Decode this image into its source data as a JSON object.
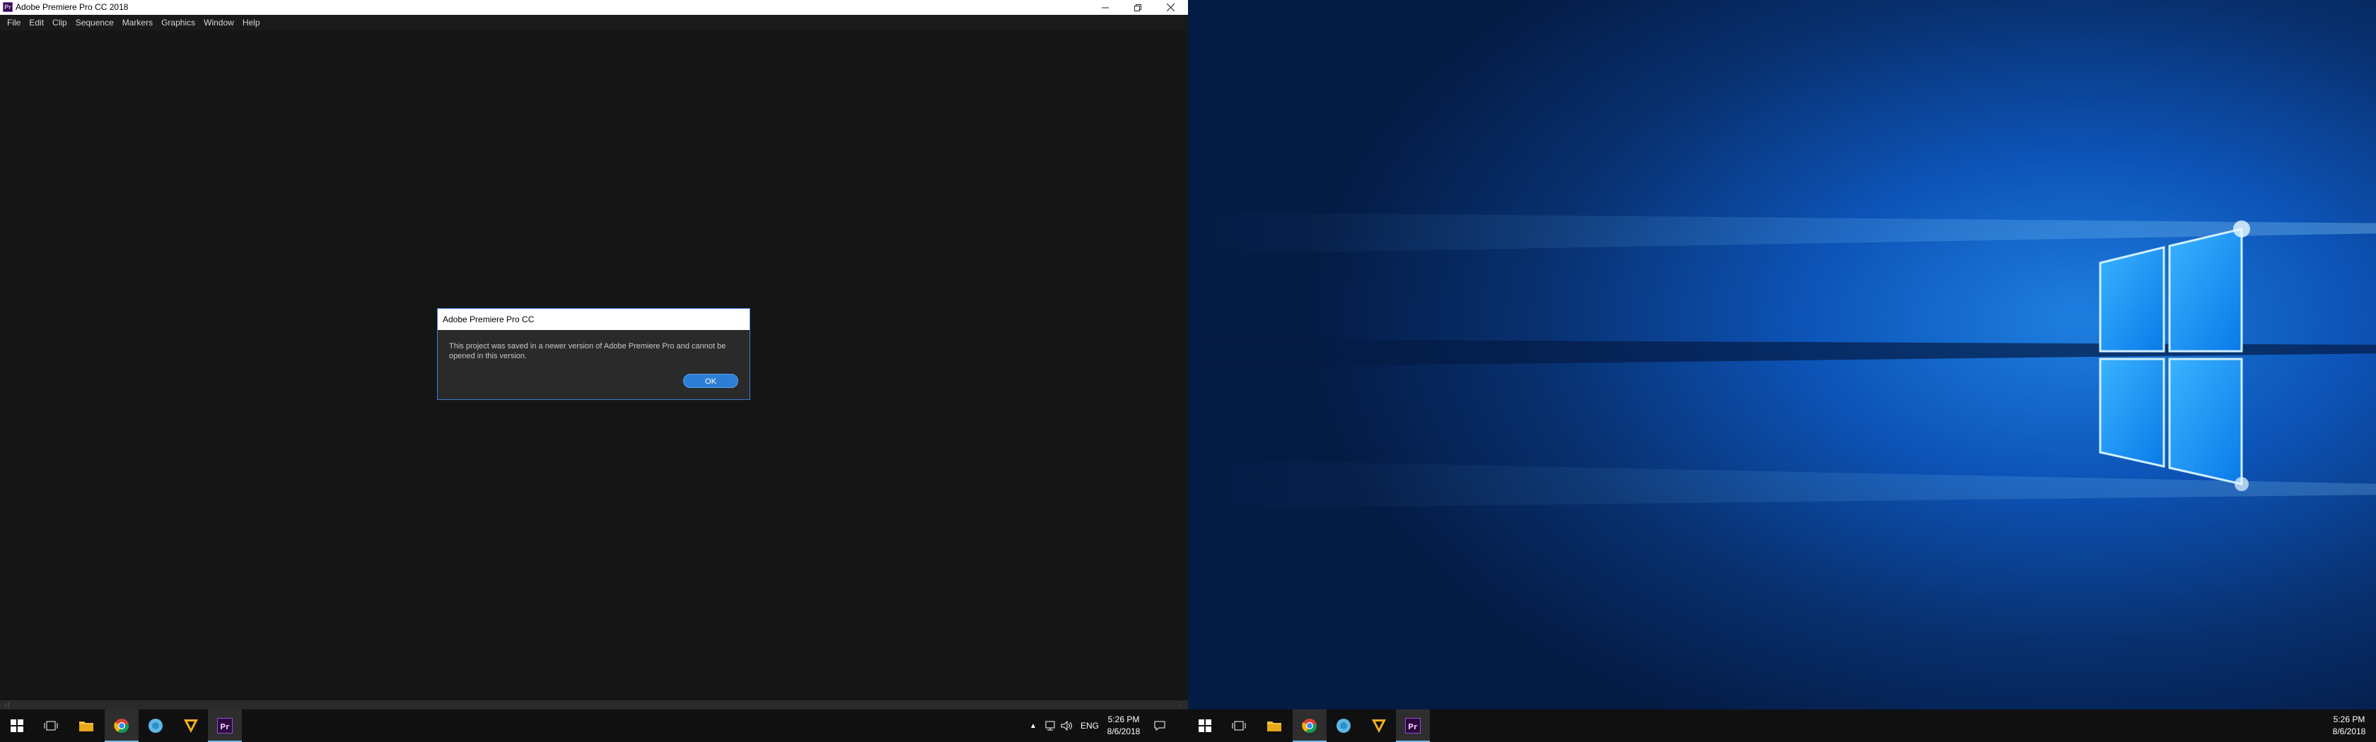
{
  "left_monitor": {
    "window": {
      "title": "Adobe Premiere Pro CC 2018",
      "icon_label": "Pr",
      "controls": [
        "minimize-icon",
        "restore-icon",
        "close-icon"
      ]
    },
    "menu": [
      "File",
      "Edit",
      "Clip",
      "Sequence",
      "Markers",
      "Graphics",
      "Window",
      "Help"
    ],
    "dialog": {
      "title": "Adobe Premiere Pro CC",
      "message_line1": "This project was saved in a newer version of Adobe Premiere Pro and cannot be",
      "message_line2": "opened in this version.",
      "ok_label": "OK"
    },
    "taskbar": {
      "apps": [
        "windows-start-icon",
        "task-view-icon",
        "file-explorer-icon",
        "chrome-icon",
        "app-circle-icon",
        "vectorworks-icon",
        "premiere-icon"
      ],
      "tray": {
        "language": "ENG",
        "time": "5:26 PM",
        "date": "8/6/2018"
      }
    }
  },
  "right_monitor": {
    "taskbar": {
      "apps": [
        "windows-start-icon",
        "task-view-icon",
        "file-explorer-icon",
        "chrome-icon",
        "app-circle-icon",
        "vectorworks-icon",
        "premiere-icon"
      ],
      "time": "5:26 PM",
      "date": "8/6/2018"
    }
  },
  "colors": {
    "accent_blue": "#2d7fd6",
    "taskbar_bg": "#101010",
    "app_bg": "#151515",
    "premiere_purple": "#2a0a3c"
  }
}
